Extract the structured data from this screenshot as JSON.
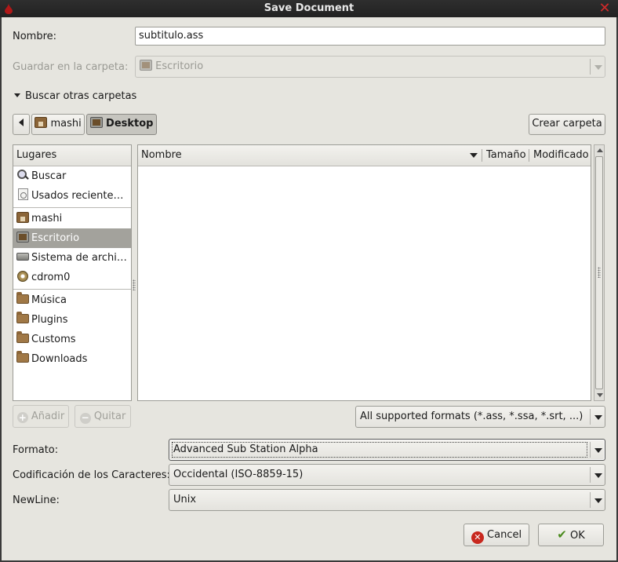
{
  "window": {
    "title": "Save Document"
  },
  "name_row": {
    "label": "Nombre:",
    "value": "subtitulo.ass"
  },
  "save_in": {
    "label": "Guardar en la carpeta:",
    "value": "Escritorio"
  },
  "browse_toggle": {
    "label": "Buscar otras carpetas"
  },
  "path_bar": {
    "back_icon": "left-arrow-icon",
    "crumbs": [
      {
        "label": "mashi",
        "icon": "home-folder-icon"
      },
      {
        "label": "Desktop",
        "icon": "desktop-folder-icon"
      }
    ]
  },
  "create_folder": {
    "label": "Crear carpeta"
  },
  "places": {
    "header": "Lugares",
    "items": [
      {
        "label": "Buscar",
        "icon": "search-icon"
      },
      {
        "label": "Usados reciente…",
        "icon": "recent-icon"
      },
      {
        "label": "mashi",
        "icon": "home-folder-icon"
      },
      {
        "label": "Escritorio",
        "icon": "desktop-folder-icon",
        "selected": true
      },
      {
        "label": "Sistema de archi…",
        "icon": "drive-icon"
      },
      {
        "label": "cdrom0",
        "icon": "cdrom-icon"
      },
      {
        "label": "Música",
        "icon": "folder-icon"
      },
      {
        "label": "Plugins",
        "icon": "folder-icon"
      },
      {
        "label": "Customs",
        "icon": "folder-icon"
      },
      {
        "label": "Downloads",
        "icon": "folder-icon"
      }
    ],
    "add_label": "Añadir",
    "remove_label": "Quitar"
  },
  "files": {
    "columns": [
      "Nombre",
      "Tamaño",
      "Modificado"
    ],
    "rows": []
  },
  "filter": {
    "value": "All supported formats (*.ass, *.ssa, *.srt, ...)"
  },
  "format": {
    "label": "Formato:",
    "value": "Advanced Sub Station Alpha"
  },
  "encoding": {
    "label": "Codificación de los Caracteres:",
    "value": "Occidental (ISO-8859-15)"
  },
  "newline": {
    "label": "NewLine:",
    "value": "Unix"
  },
  "actions": {
    "cancel": "Cancel",
    "ok": "OK"
  },
  "colors": {
    "dialog_bg": "#e6e5df",
    "selection": "#a3a29c",
    "titlebar": "#262626",
    "close": "#d02a2a"
  }
}
